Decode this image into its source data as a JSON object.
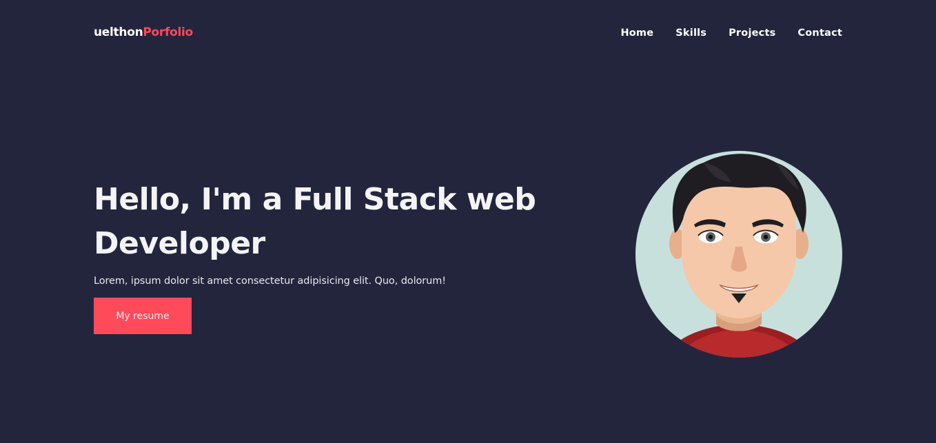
{
  "header": {
    "logo_main": "uelthon",
    "logo_accent": "Porfolio",
    "nav": [
      "Home",
      "Skills",
      "Projects",
      "Contact"
    ]
  },
  "hero": {
    "title_line1": "Hello, I'm a Full Stack web",
    "title_line2": "Developer",
    "subtitle": "Lorem, ipsum dolor sit amet consectetur adipisicing elit. Quo, dolorum!",
    "button_label": "My resume"
  },
  "colors": {
    "background": "#23253d",
    "accent": "#ff4a5a",
    "text": "#ffffff"
  },
  "icons": {
    "avatar": "cartoon-avatar"
  }
}
